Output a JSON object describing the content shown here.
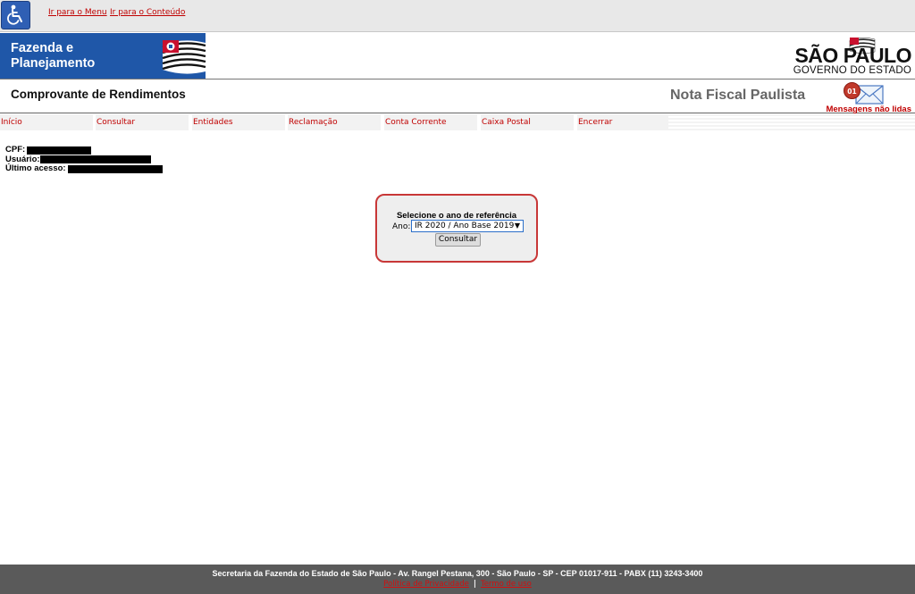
{
  "accessibility": {
    "icon": "wheelchair-icon",
    "links": [
      "Ir para o Menu",
      "Ir para o Conteúdo"
    ]
  },
  "header": {
    "brand": "Fazenda e\nPlanejamento",
    "logo_main": "SÃO PAULO",
    "logo_sub": "GOVERNO DO ESTADO"
  },
  "title_row": {
    "page_title": "Comprovante de Rendimentos",
    "nfp_title": "Nota Fiscal Paulista",
    "message_count": "01",
    "message_label": "Mensagens não lidas"
  },
  "menu": [
    "Início",
    "Consultar",
    "Entidades",
    "Reclamação",
    "Conta Corrente",
    "Caixa Postal",
    "Encerrar"
  ],
  "user_info": {
    "cpf_label": "CPF:",
    "usuario_label": "Usuário:",
    "ultimo_acesso_label": "Último acesso:"
  },
  "form": {
    "title": "Selecione o ano de referência",
    "ano_label": "Ano:",
    "selected_year": "IR 2020 / Ano Base 2019",
    "button": "Consultar"
  },
  "footer": {
    "address": "Secretaria da Fazenda do Estado de São Paulo - Av. Rangel Pestana, 300 - São Paulo - SP - CEP 01017-911 - PABX (11) 3243-3400",
    "links": [
      "Política de Privacidade",
      "Termo de uso"
    ]
  },
  "colors": {
    "brand_blue": "#1f57a8",
    "link_red": "#c00000",
    "box_border": "#c83737",
    "footer_bg": "#5a5a5a"
  }
}
